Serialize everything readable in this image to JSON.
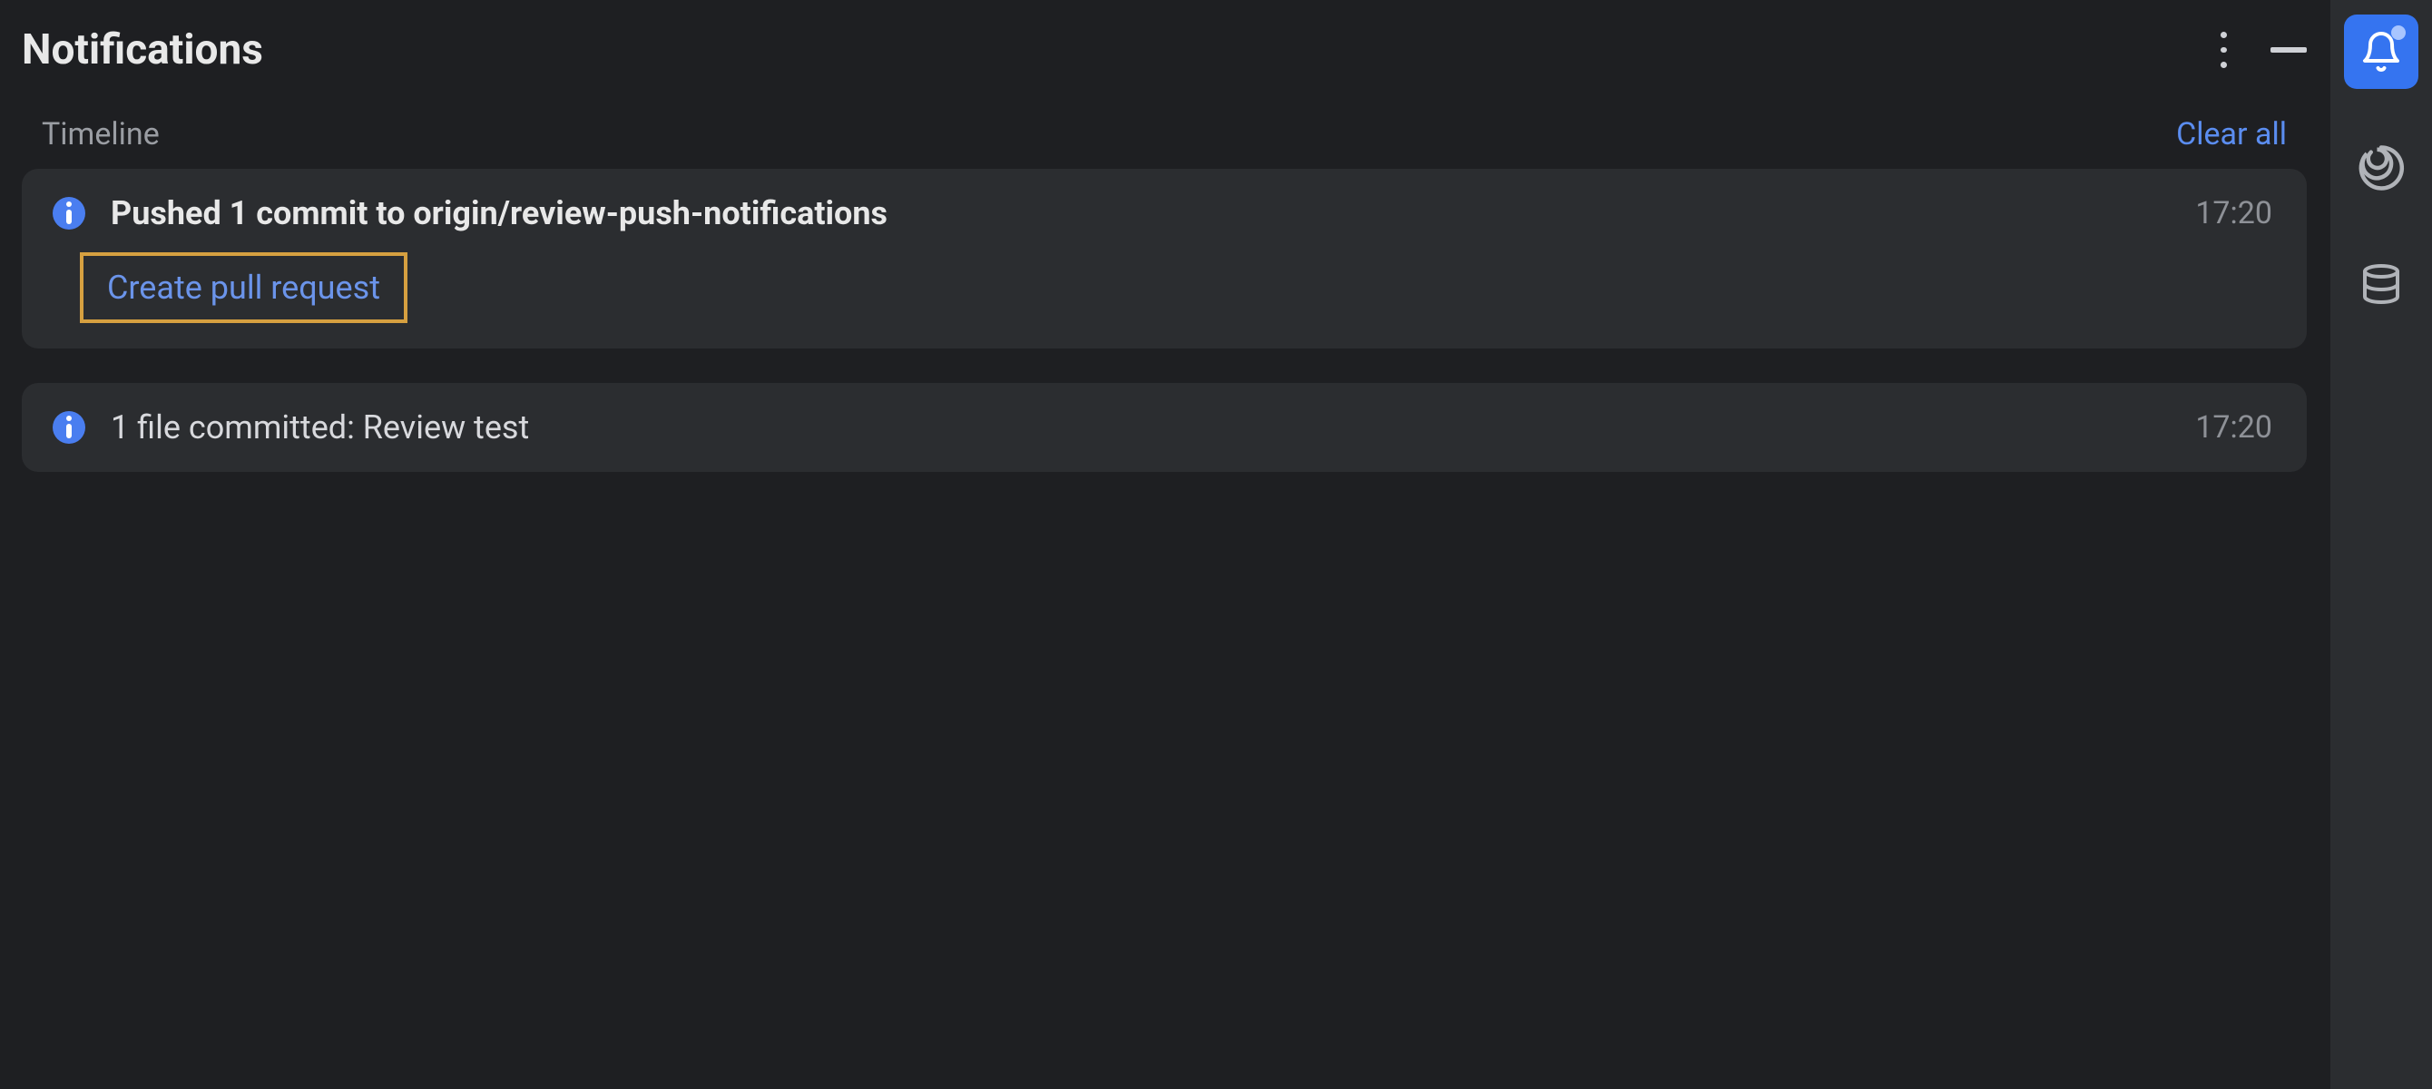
{
  "panel": {
    "title": "Notifications"
  },
  "section": {
    "label": "Timeline",
    "clear_all": "Clear all"
  },
  "notifications": [
    {
      "title": "Pushed 1 commit to origin/review-push-notifications",
      "time": "17:20",
      "action": "Create pull request"
    },
    {
      "title": "1 file committed: Review test",
      "time": "17:20"
    }
  ],
  "sidebar": {
    "items": [
      "notifications",
      "spiral",
      "database"
    ]
  }
}
